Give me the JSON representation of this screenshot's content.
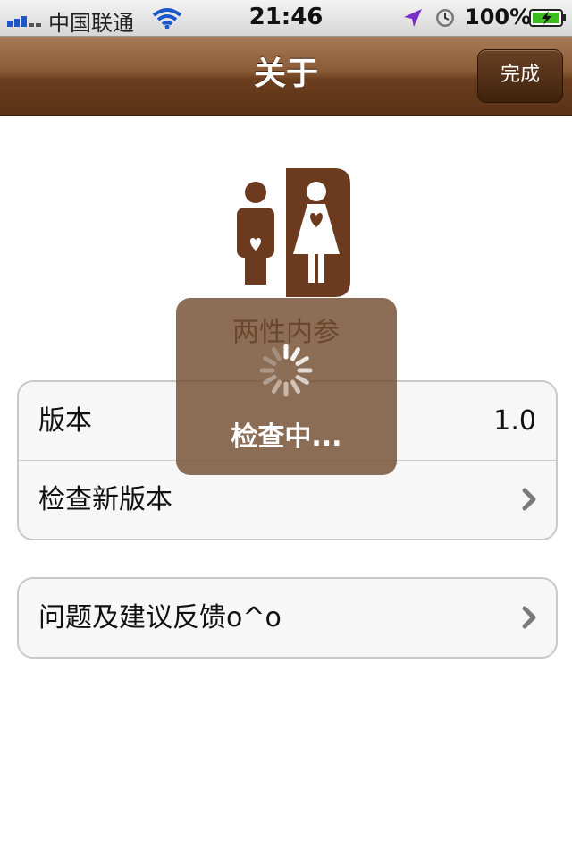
{
  "status_bar": {
    "carrier": "中国联通",
    "time": "21:46",
    "battery_percent": "100%",
    "icons": [
      "signal-icon",
      "wifi-icon",
      "location-icon",
      "alarm-icon",
      "battery-charging-icon"
    ]
  },
  "nav": {
    "title": "关于",
    "done_label": "完成"
  },
  "app": {
    "name": "两性内参",
    "icon": "app-logo-icon"
  },
  "sections": {
    "info": {
      "version_label": "版本",
      "version_value": "1.0",
      "check_update_label": "检查新版本"
    },
    "feedback": {
      "label": "问题及建议反馈o^o"
    }
  },
  "hud": {
    "text": "检查中..."
  },
  "colors": {
    "nav_brown": "#6b3e1e",
    "icon_brown": "#6b3a1f",
    "hud_background": "#734d30"
  }
}
